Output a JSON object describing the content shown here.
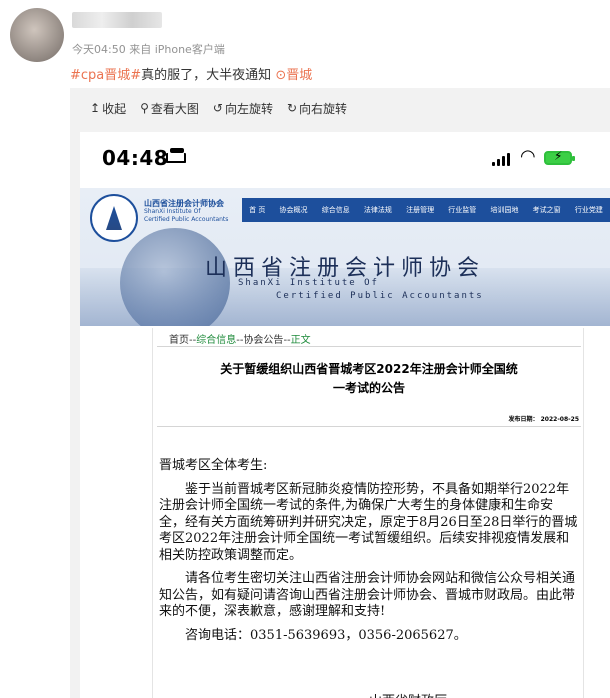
{
  "post": {
    "meta": "今天04:50  来自 iPhone客户端",
    "hashtag": "#cpa晋城#",
    "text": "真的服了，大半夜通知",
    "location": "晋城"
  },
  "toolbar": {
    "collapse": "收起",
    "view_large": "查看大图",
    "rotate_left": "向左旋转",
    "rotate_right": "向右旋转"
  },
  "phone": {
    "time": "04:48"
  },
  "site": {
    "logo_cn": "山西省注册会计师协会",
    "logo_en1": "ShanXi Institute Of",
    "logo_en2": "Certified Public Accountants",
    "nav": [
      "首 页",
      "协会概况",
      "综合信息",
      "法律法规",
      "注册管理",
      "行业监管",
      "培训园地",
      "考试之窗",
      "行业党建"
    ],
    "title": "山西省注册会计师协会",
    "en_line1": "ShanXi Institute Of",
    "en_line2": "Certified Public Accountants"
  },
  "article": {
    "crumb_home": "首页",
    "crumb_sep1": "--",
    "crumb_info": "综合信息",
    "crumb_sep2": "--",
    "crumb_notice": "协会公告",
    "crumb_sep3": "--",
    "crumb_body": "正文",
    "title_line1": "关于暂缓组织山西省晋城考区2022年注册会计师全国统",
    "title_line2": "一考试的公告",
    "date": "发布日期：  2022-08-25",
    "salutation": "晋城考区全体考生:",
    "para1": "鉴于当前晋城考区新冠肺炎疫情防控形势，不具备如期举行2022年注册会计师全国统一考试的条件,为确保广大考生的身体健康和生命安全，经有关方面统筹研判并研究决定，原定于8月26日至28日举行的晋城考区2022年注册会计师全国统一考试暂缓组织。后续安排视疫情发展和相关防控政策调整而定。",
    "para2": "请各位考生密切关注山西省注册会计师协会网站和微信公众号相关通知公告，如有疑问请咨询山西省注册会计师协会、晋城市财政局。由此带来的不便，深表歉意，感谢理解和支持!",
    "phone": "咨询电话：0351-5639693，0356-2065627。",
    "sign1": "山西省财政厅"
  }
}
